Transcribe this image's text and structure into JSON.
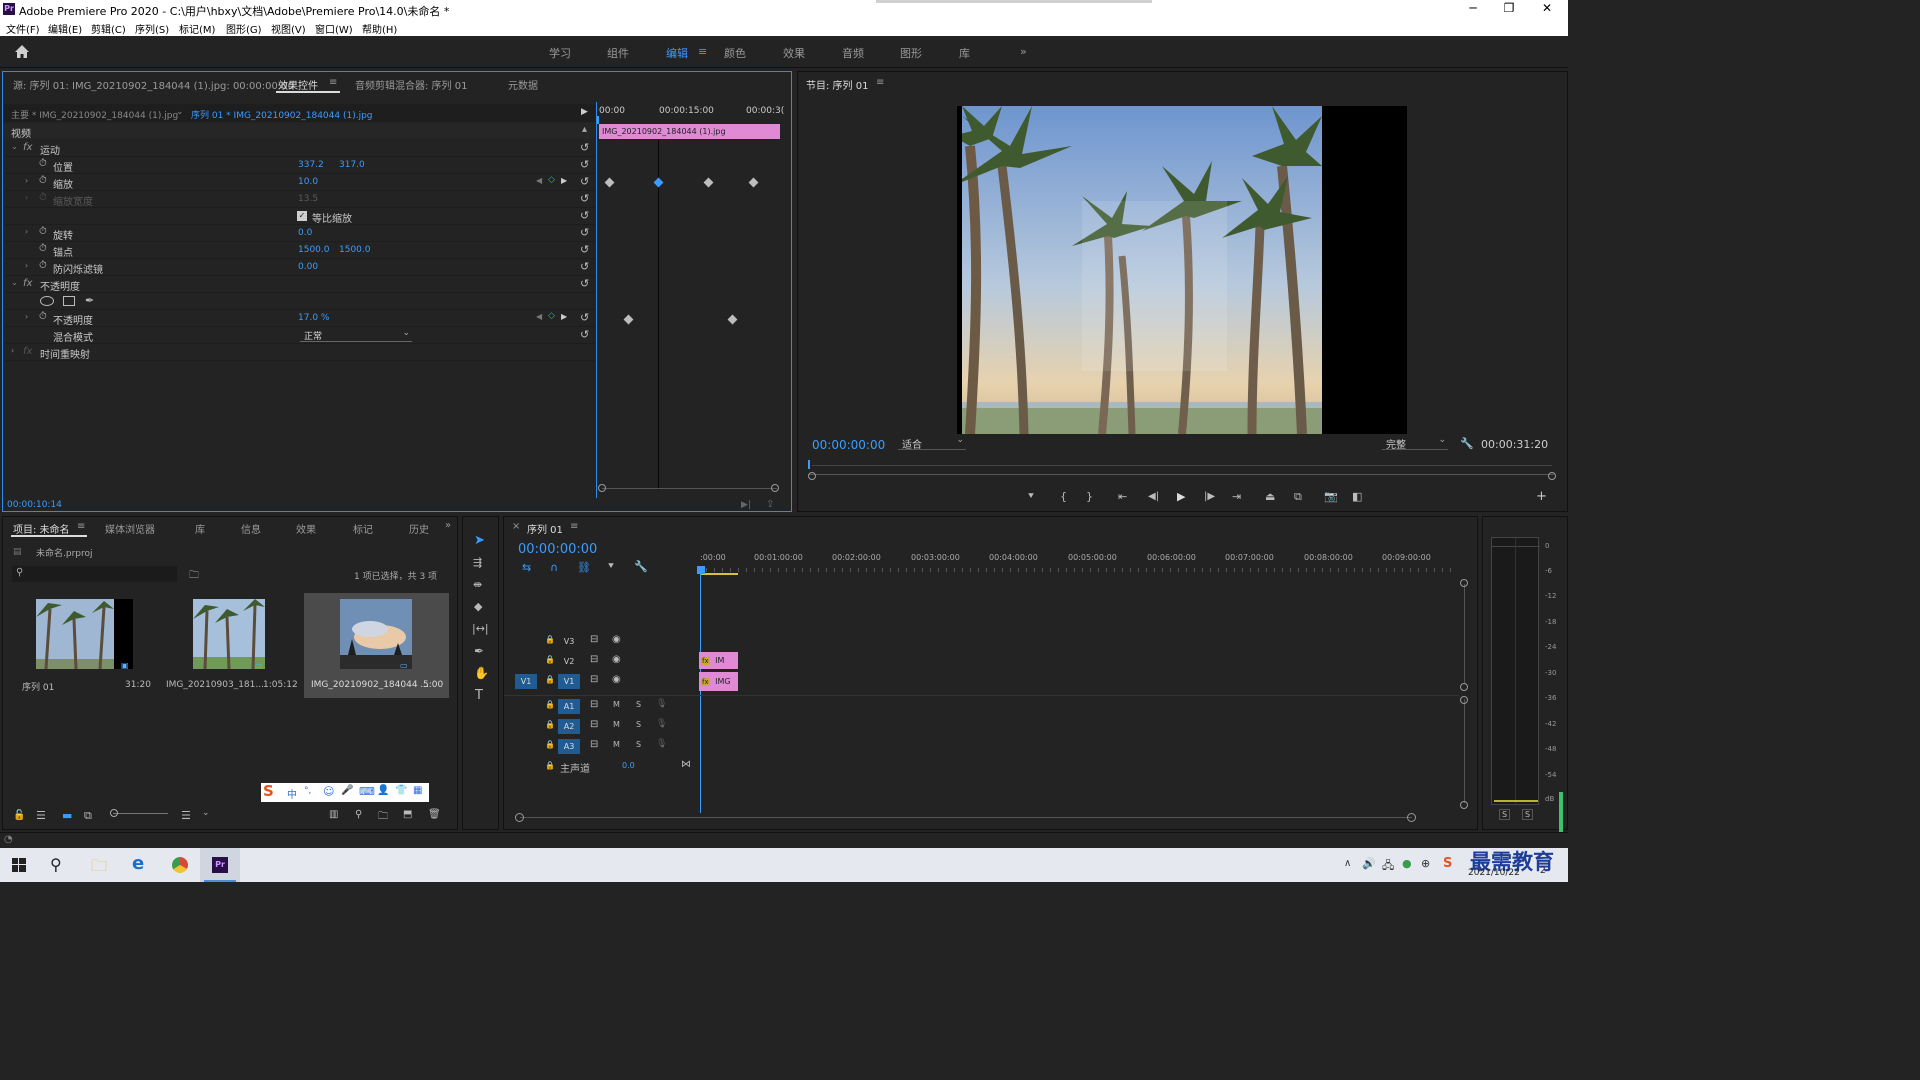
{
  "window": {
    "title": "Adobe Premiere Pro 2020 - C:\\用户\\hbxy\\文档\\Adobe\\Premiere Pro\\14.0\\未命名 *",
    "logo": "Pr",
    "minimize": "─",
    "maximize": "❐",
    "close": "✕"
  },
  "menu": [
    "文件(F)",
    "编辑(E)",
    "剪辑(C)",
    "序列(S)",
    "标记(M)",
    "图形(G)",
    "视图(V)",
    "窗口(W)",
    "帮助(H)"
  ],
  "workspaces": [
    "学习",
    "组件",
    "编辑",
    "颜色",
    "效果",
    "音频",
    "图形",
    "库"
  ],
  "workspace_active": "编辑",
  "workspace_more": "»",
  "source_panel": {
    "tabs": [
      "源: 序列 01: IMG_20210902_184044 (1).jpg: 00:00:00:00",
      "效果控件",
      "音频剪辑混合器: 序列 01",
      "元数据"
    ],
    "active_tab": "效果控件",
    "master_label": "主要 * IMG_20210902_184044 (1).jpg",
    "sequence_label": "序列 01 * IMG_20210902_184044 (1).jpg",
    "section_video": "视频",
    "rows": [
      {
        "label": "运动"
      },
      {
        "label": "位置",
        "v1": "337.2",
        "v2": "317.0"
      },
      {
        "label": "缩放",
        "v1": "10.0"
      },
      {
        "label": "缩放宽度",
        "v1": "13.5"
      },
      {
        "label": "等比缩放"
      },
      {
        "label": "旋转",
        "v1": "0.0"
      },
      {
        "label": "锚点",
        "v1": "1500.0",
        "v2": "1500.0"
      },
      {
        "label": "防闪烁滤镜",
        "v1": "0.00"
      },
      {
        "label": "不透明度"
      },
      {
        "label": "不透明度",
        "v1": "17.0 %"
      },
      {
        "label": "混合模式",
        "v1": "正常"
      },
      {
        "label": "时间重映射"
      }
    ],
    "timecodes": [
      "00:00",
      "00:00:15:00",
      "00:00:3("
    ],
    "clip_name": "IMG_20210902_184044 (1).jpg",
    "current_time": "00:00:10:14"
  },
  "program_panel": {
    "title": "节目: 序列 01",
    "timecode": "00:00:00:00",
    "fit": "适合",
    "quality": "完整",
    "duration": "00:00:31:20"
  },
  "project_panel": {
    "tabs": [
      "项目: 未命名",
      "媒体浏览器",
      "库",
      "信息",
      "效果",
      "标记",
      "历史"
    ],
    "active_tab": "项目: 未命名",
    "project_file": "未命名.prproj",
    "search_placeholder": "",
    "selection": "1 项已选择，共 3 项",
    "items": [
      {
        "name": "序列 01",
        "duration": "31:20"
      },
      {
        "name": "IMG_20210903_181...",
        "duration": "1:05:12"
      },
      {
        "name": "IMG_20210902_184044 ...",
        "duration": "5:00"
      }
    ],
    "ime": [
      "中",
      "°,",
      "☺",
      "🎤",
      "⌨",
      "👤",
      "👕",
      "▦"
    ]
  },
  "timeline_panel": {
    "title": "序列 01",
    "timecode": "00:00:00:00",
    "ruler": [
      ":00:00",
      "00:01:00:00",
      "00:02:00:00",
      "00:03:00:00",
      "00:04:00:00",
      "00:05:00:00",
      "00:06:00:00",
      "00:07:00:00",
      "00:08:00:00",
      "00:09:00:00"
    ],
    "video_tracks": [
      "V3",
      "V2",
      "V1"
    ],
    "source_patch": "V1",
    "audio_tracks": [
      "A1",
      "A2",
      "A3"
    ],
    "master": "主声道",
    "master_value": "0.0",
    "mute": "M",
    "solo": "S",
    "clips": [
      {
        "track": "V2",
        "label": "IM"
      },
      {
        "track": "V1",
        "label": "IMG"
      }
    ]
  },
  "meter": {
    "scale": [
      "0",
      "-6",
      "-12",
      "-18",
      "-24",
      "-30",
      "-36",
      "-42",
      "-48",
      "-54",
      "dB"
    ],
    "solo": [
      "S",
      "S"
    ]
  },
  "taskbar": {
    "time": "",
    "date": "2021/10/22",
    "watermark": "最需教育",
    "notification": "2"
  }
}
